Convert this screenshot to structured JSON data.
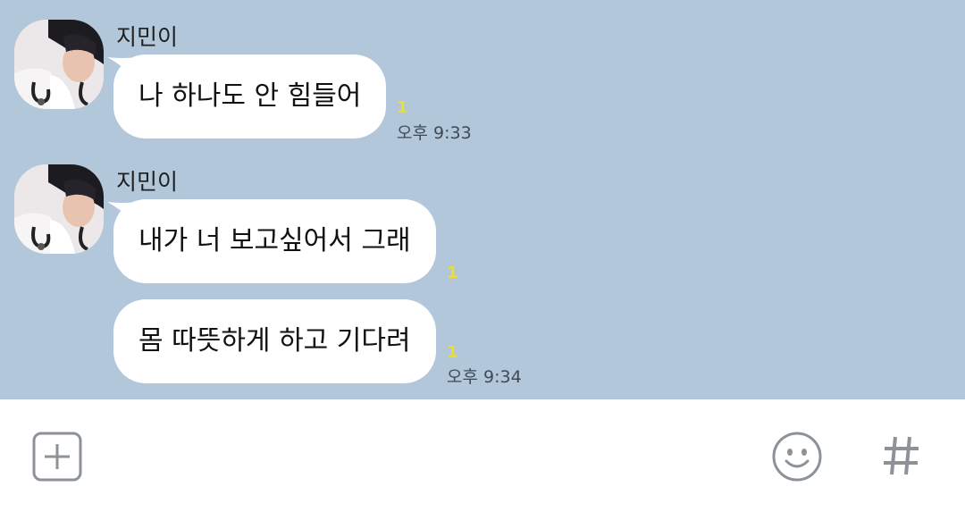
{
  "messages": [
    {
      "sender": "지민이",
      "avatar_icon": "profile-photo",
      "lines": [
        {
          "text": "나 하나도 안 힘들어",
          "unread": "1",
          "time": "오후 9:33"
        }
      ]
    },
    {
      "sender": "지민이",
      "avatar_icon": "profile-photo",
      "lines": [
        {
          "text": "내가 너 보고싶어서 그래",
          "unread": "1",
          "time": ""
        },
        {
          "text": "몸 따뜻하게 하고 기다려",
          "unread": "1",
          "time": "오후 9:34"
        }
      ]
    }
  ],
  "input_bar": {
    "add_icon": "plus-square-icon",
    "emoji_icon": "smiley-icon",
    "hashtag_icon": "hash-icon"
  },
  "colors": {
    "chat_background": "#b2c7da",
    "bubble": "#ffffff",
    "unread_count": "#f0dc30"
  }
}
